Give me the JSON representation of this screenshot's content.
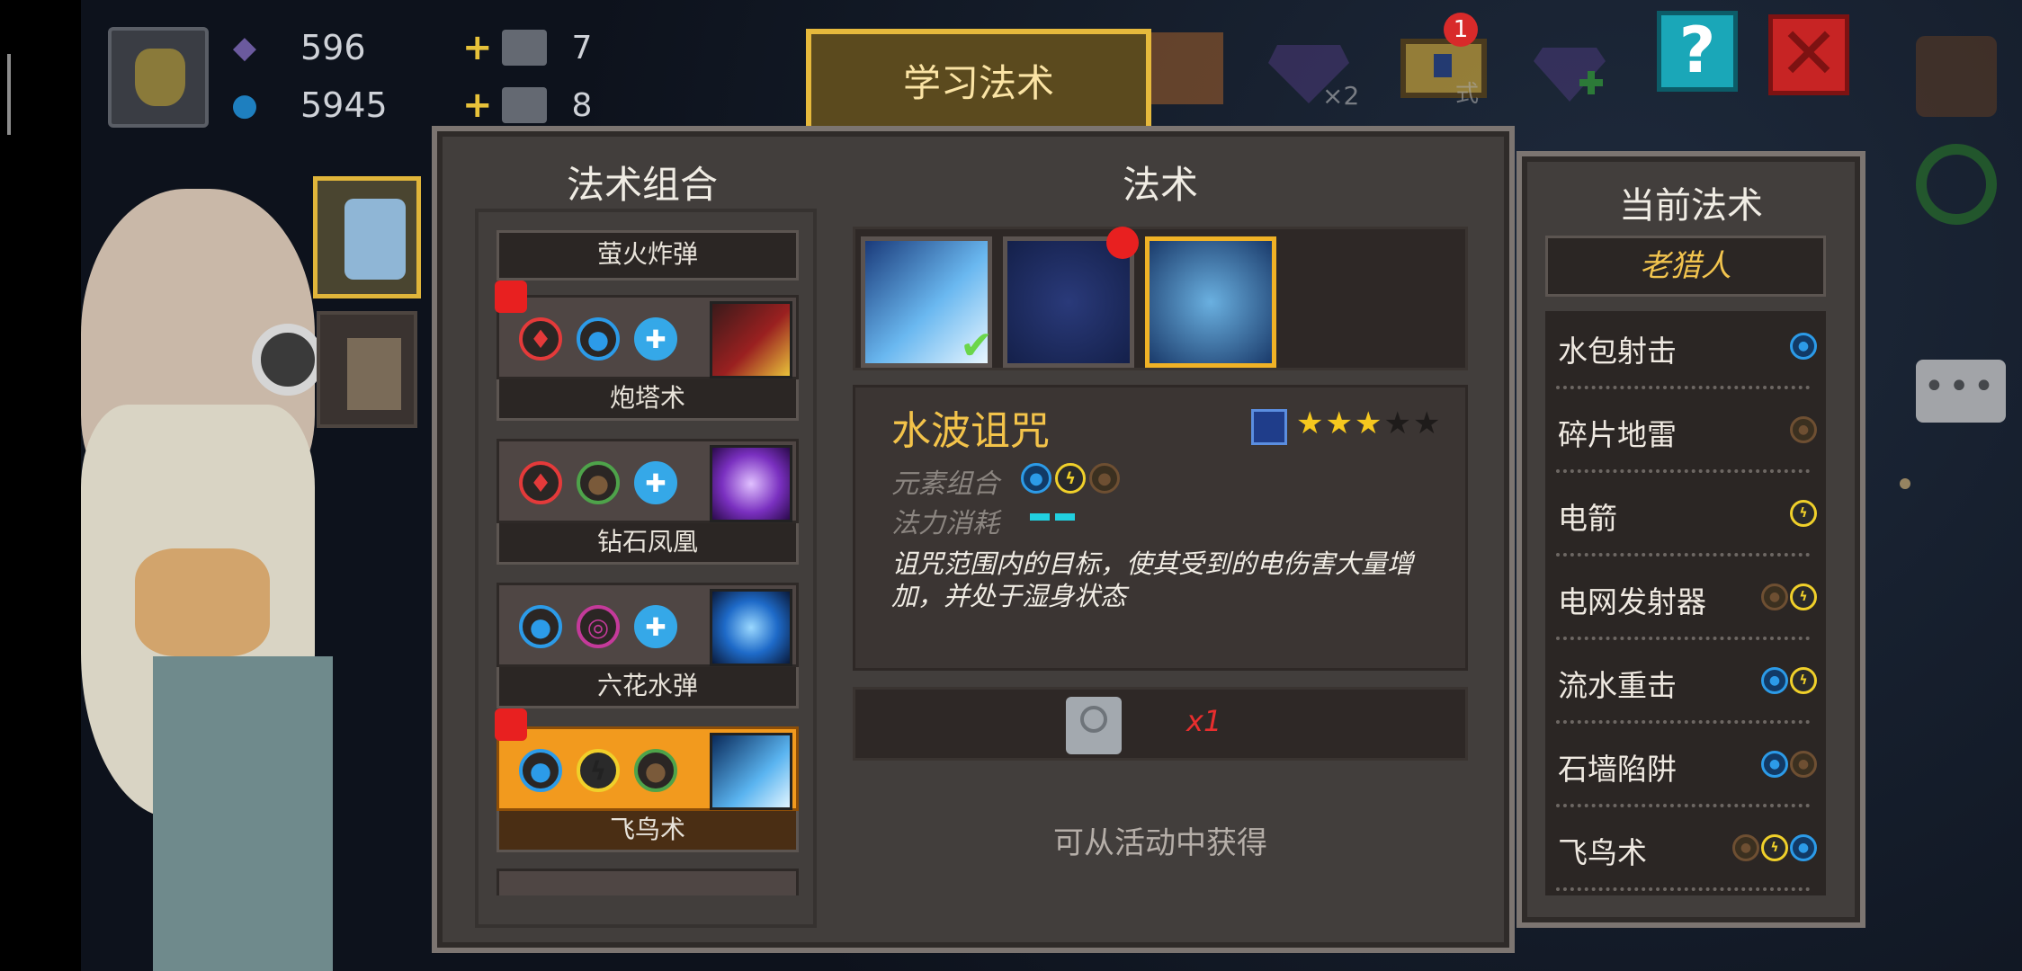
{
  "resources": {
    "gems": "596",
    "coins": "5945",
    "item1_count": "7",
    "item2_count": "8"
  },
  "header": {
    "tab_title": "学习法术",
    "chest_badge": "1",
    "chest_label": "式",
    "gem_multiplier": "×2"
  },
  "combos": {
    "title": "法术组合",
    "top_partial": "萤火炸弹",
    "items": [
      {
        "name": "炮塔术",
        "elements": [
          "fire",
          "water",
          "ice"
        ],
        "new": true,
        "selected": false
      },
      {
        "name": "钻石凤凰",
        "elements": [
          "fire",
          "earth",
          "ice"
        ],
        "new": false,
        "selected": false
      },
      {
        "name": "六花水弹",
        "elements": [
          "water",
          "wind",
          "ice"
        ],
        "new": false,
        "selected": false
      },
      {
        "name": "飞鸟术",
        "elements": [
          "water",
          "elec",
          "earth"
        ],
        "new": true,
        "selected": true
      }
    ]
  },
  "spells": {
    "title": "法术",
    "detail": {
      "name": "水波诅咒",
      "stars": 3,
      "stars_max": 5,
      "element_label": "元素组合",
      "mana_label": "法力消耗",
      "mana_cost": 2,
      "description": "诅咒范围内的目标，使其受到的电伤害大量增加，并处于湿身状态"
    },
    "cost_qty": "x1",
    "source_note": "可从活动中获得"
  },
  "current": {
    "title": "当前法术",
    "owner": "老猎人",
    "items": [
      {
        "name": "水包射击",
        "elements": [
          "water"
        ]
      },
      {
        "name": "碎片地雷",
        "elements": [
          "earth"
        ]
      },
      {
        "name": "电箭",
        "elements": [
          "elec"
        ]
      },
      {
        "name": "电网发射器",
        "elements": [
          "earth",
          "elec"
        ]
      },
      {
        "name": "流水重击",
        "elements": [
          "water",
          "elec"
        ]
      },
      {
        "name": "石墙陷阱",
        "elements": [
          "water",
          "earth"
        ]
      },
      {
        "name": "飞鸟术",
        "elements": [
          "earth",
          "elec",
          "water"
        ]
      }
    ]
  },
  "colors": {
    "accent_gold": "#e6b93c",
    "selected_orange": "#f29a1e",
    "spell_name": "#f3c34a",
    "mana": "#21d0e0",
    "cost_red": "#e82e2e"
  },
  "icons": {
    "help": "question-mark-icon",
    "close": "close-x-icon",
    "chat": "chat-bubble-icon"
  }
}
